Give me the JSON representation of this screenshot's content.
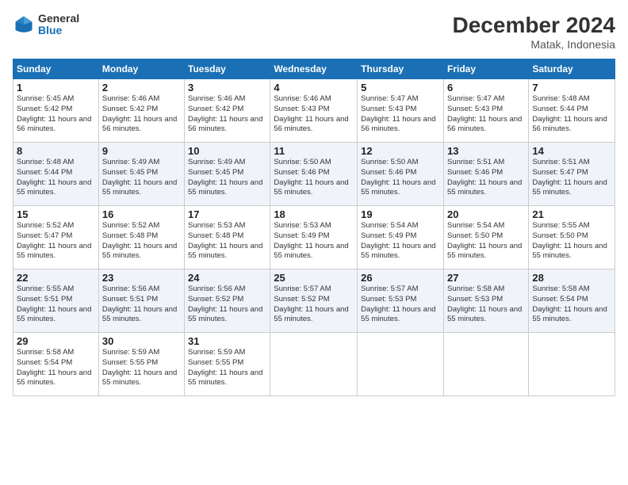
{
  "logo": {
    "general": "General",
    "blue": "Blue"
  },
  "title": "December 2024",
  "location": "Matak, Indonesia",
  "days_of_week": [
    "Sunday",
    "Monday",
    "Tuesday",
    "Wednesday",
    "Thursday",
    "Friday",
    "Saturday"
  ],
  "weeks": [
    [
      {
        "day": "1",
        "sunrise": "5:45 AM",
        "sunset": "5:42 PM",
        "daylight": "11 hours and 56 minutes."
      },
      {
        "day": "2",
        "sunrise": "5:46 AM",
        "sunset": "5:42 PM",
        "daylight": "11 hours and 56 minutes."
      },
      {
        "day": "3",
        "sunrise": "5:46 AM",
        "sunset": "5:42 PM",
        "daylight": "11 hours and 56 minutes."
      },
      {
        "day": "4",
        "sunrise": "5:46 AM",
        "sunset": "5:43 PM",
        "daylight": "11 hours and 56 minutes."
      },
      {
        "day": "5",
        "sunrise": "5:47 AM",
        "sunset": "5:43 PM",
        "daylight": "11 hours and 56 minutes."
      },
      {
        "day": "6",
        "sunrise": "5:47 AM",
        "sunset": "5:43 PM",
        "daylight": "11 hours and 56 minutes."
      },
      {
        "day": "7",
        "sunrise": "5:48 AM",
        "sunset": "5:44 PM",
        "daylight": "11 hours and 56 minutes."
      }
    ],
    [
      {
        "day": "8",
        "sunrise": "5:48 AM",
        "sunset": "5:44 PM",
        "daylight": "11 hours and 55 minutes."
      },
      {
        "day": "9",
        "sunrise": "5:49 AM",
        "sunset": "5:45 PM",
        "daylight": "11 hours and 55 minutes."
      },
      {
        "day": "10",
        "sunrise": "5:49 AM",
        "sunset": "5:45 PM",
        "daylight": "11 hours and 55 minutes."
      },
      {
        "day": "11",
        "sunrise": "5:50 AM",
        "sunset": "5:46 PM",
        "daylight": "11 hours and 55 minutes."
      },
      {
        "day": "12",
        "sunrise": "5:50 AM",
        "sunset": "5:46 PM",
        "daylight": "11 hours and 55 minutes."
      },
      {
        "day": "13",
        "sunrise": "5:51 AM",
        "sunset": "5:46 PM",
        "daylight": "11 hours and 55 minutes."
      },
      {
        "day": "14",
        "sunrise": "5:51 AM",
        "sunset": "5:47 PM",
        "daylight": "11 hours and 55 minutes."
      }
    ],
    [
      {
        "day": "15",
        "sunrise": "5:52 AM",
        "sunset": "5:47 PM",
        "daylight": "11 hours and 55 minutes."
      },
      {
        "day": "16",
        "sunrise": "5:52 AM",
        "sunset": "5:48 PM",
        "daylight": "11 hours and 55 minutes."
      },
      {
        "day": "17",
        "sunrise": "5:53 AM",
        "sunset": "5:48 PM",
        "daylight": "11 hours and 55 minutes."
      },
      {
        "day": "18",
        "sunrise": "5:53 AM",
        "sunset": "5:49 PM",
        "daylight": "11 hours and 55 minutes."
      },
      {
        "day": "19",
        "sunrise": "5:54 AM",
        "sunset": "5:49 PM",
        "daylight": "11 hours and 55 minutes."
      },
      {
        "day": "20",
        "sunrise": "5:54 AM",
        "sunset": "5:50 PM",
        "daylight": "11 hours and 55 minutes."
      },
      {
        "day": "21",
        "sunrise": "5:55 AM",
        "sunset": "5:50 PM",
        "daylight": "11 hours and 55 minutes."
      }
    ],
    [
      {
        "day": "22",
        "sunrise": "5:55 AM",
        "sunset": "5:51 PM",
        "daylight": "11 hours and 55 minutes."
      },
      {
        "day": "23",
        "sunrise": "5:56 AM",
        "sunset": "5:51 PM",
        "daylight": "11 hours and 55 minutes."
      },
      {
        "day": "24",
        "sunrise": "5:56 AM",
        "sunset": "5:52 PM",
        "daylight": "11 hours and 55 minutes."
      },
      {
        "day": "25",
        "sunrise": "5:57 AM",
        "sunset": "5:52 PM",
        "daylight": "11 hours and 55 minutes."
      },
      {
        "day": "26",
        "sunrise": "5:57 AM",
        "sunset": "5:53 PM",
        "daylight": "11 hours and 55 minutes."
      },
      {
        "day": "27",
        "sunrise": "5:58 AM",
        "sunset": "5:53 PM",
        "daylight": "11 hours and 55 minutes."
      },
      {
        "day": "28",
        "sunrise": "5:58 AM",
        "sunset": "5:54 PM",
        "daylight": "11 hours and 55 minutes."
      }
    ],
    [
      {
        "day": "29",
        "sunrise": "5:58 AM",
        "sunset": "5:54 PM",
        "daylight": "11 hours and 55 minutes."
      },
      {
        "day": "30",
        "sunrise": "5:59 AM",
        "sunset": "5:55 PM",
        "daylight": "11 hours and 55 minutes."
      },
      {
        "day": "31",
        "sunrise": "5:59 AM",
        "sunset": "5:55 PM",
        "daylight": "11 hours and 55 minutes."
      },
      null,
      null,
      null,
      null
    ]
  ]
}
